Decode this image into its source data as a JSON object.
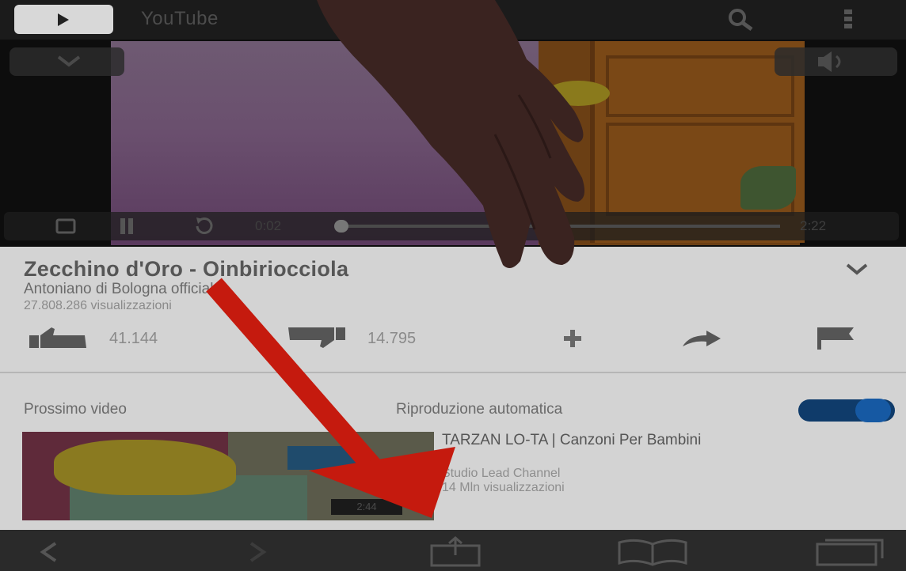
{
  "header": {
    "brand": "YouTube",
    "icons": {
      "logo": "youtube-play-icon",
      "search": "search-icon",
      "menu": "more-vert-icon"
    }
  },
  "player": {
    "current_time": "0:02",
    "duration": "2:22",
    "progress": 0.02
  },
  "video": {
    "title": "Zecchino d'Oro - Oinbiriocciola",
    "channel": "Antoniano di Bologna official",
    "views": "27.808.286 visualizzazioni",
    "likes": "41.144",
    "dislikes": "14.795"
  },
  "up_next": {
    "label": "Prossimo video",
    "autoplay_label": "Riproduzione automatica",
    "autoplay_on": true,
    "item": {
      "title": "TARZAN LO-TA | Canzoni Per Bambini",
      "channel": "Studio Lead Channel",
      "views": "14 Mln visualizzazioni",
      "duration": "2:44"
    }
  },
  "colors": {
    "topbar": "#1b1b1b",
    "page": "#d3d3d3",
    "arrow": "#c51a0e",
    "toggle": "#1659a3"
  }
}
